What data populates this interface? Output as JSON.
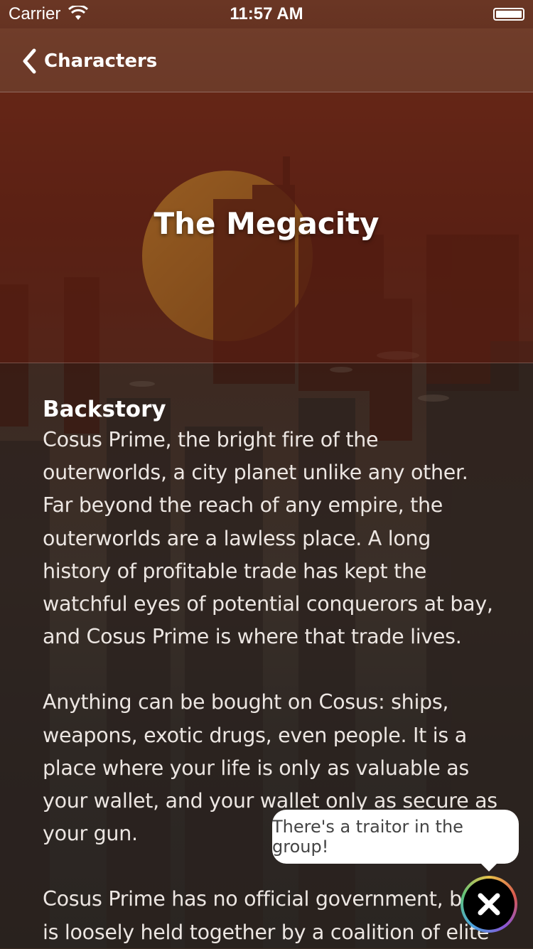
{
  "status_bar": {
    "carrier": "Carrier",
    "time": "11:57 AM"
  },
  "nav": {
    "back_label": "Characters"
  },
  "hero": {
    "title": "The Megacity"
  },
  "content": {
    "heading": "Backstory",
    "paragraphs": [
      "Cosus Prime, the bright fire of the outerworlds, a city planet unlike any other. Far beyond the reach of any empire, the outerworlds are a lawless place. A long history of profitable trade has kept the watchful eyes of potential conquerors at bay, and Cosus Prime is where that trade lives.",
      "Anything can be bought on Cosus: ships, weapons, exotic drugs, even people. It is a place where your life is only as valuable as your wallet, and your wallet only as secure as your gun.",
      "Cosus Prime has no official government, but is loosely held together by a coalition of elite"
    ]
  },
  "tooltip": {
    "text": "There's a traitor in the group!"
  },
  "icons": {
    "back": "chevron-left-icon",
    "close": "close-icon",
    "wifi": "wifi-icon",
    "battery": "battery-icon"
  },
  "colors": {
    "accent": "#ffffff",
    "tooltip_bg": "#ffffff"
  }
}
